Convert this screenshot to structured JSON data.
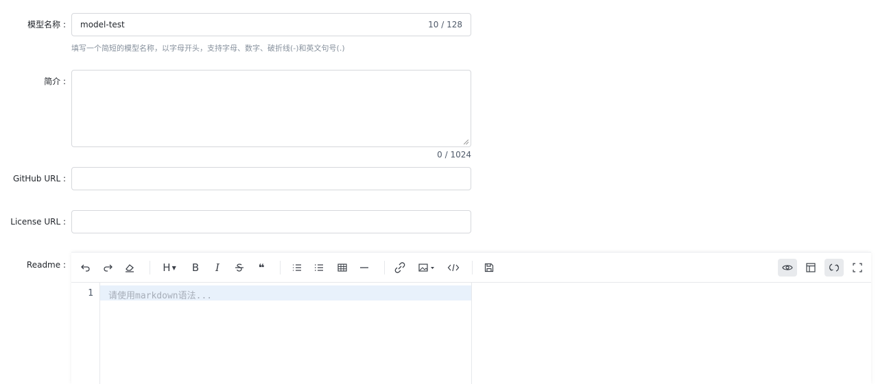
{
  "form": {
    "name_label": "模型名称 :",
    "name_value": "model-test",
    "name_counter": "10 / 128",
    "name_hint": "填写一个简短的模型名称，以字母开头，支持字母、数字、破折线(-)和英文句号(.)",
    "intro_label": "简介 :",
    "intro_value": "",
    "intro_counter": "0 / 1024",
    "github_label": "GitHub URL :",
    "github_value": "",
    "license_label": "License URL :",
    "license_value": "",
    "readme_label": "Readme :"
  },
  "editor": {
    "toolbar": {
      "heading": "H",
      "bold": "B",
      "italic": "I",
      "quote": "❝"
    },
    "line_number": "1",
    "placeholder": "请使用markdown语法..."
  }
}
